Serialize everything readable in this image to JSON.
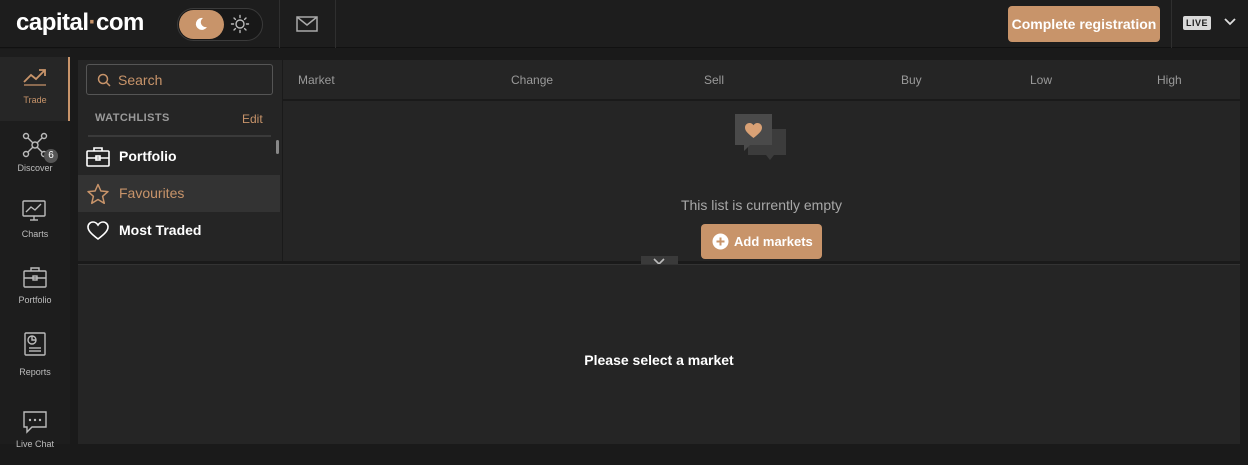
{
  "header": {
    "logo_left": "capital",
    "logo_dot": "·",
    "logo_right": "com",
    "register_label": "Complete registration",
    "account_badge": "LIVE"
  },
  "nav": {
    "items": [
      {
        "label": "Trade",
        "icon": "trend-line-icon"
      },
      {
        "label": "Discover",
        "icon": "network-icon"
      },
      {
        "label": "Charts",
        "icon": "chart-monitor-icon",
        "badge": "6"
      },
      {
        "label": "Portfolio",
        "icon": "briefcase-icon"
      },
      {
        "label": "Reports",
        "icon": "report-icon"
      },
      {
        "label": "Live Chat",
        "icon": "chat-icon"
      }
    ]
  },
  "watchlists": {
    "search_placeholder": "Search",
    "title": "WATCHLISTS",
    "edit_label": "Edit",
    "items": [
      {
        "label": "Portfolio",
        "icon": "briefcase-icon"
      },
      {
        "label": "Favourites",
        "icon": "star-icon"
      },
      {
        "label": "Most Traded",
        "icon": "heart-icon"
      }
    ]
  },
  "table": {
    "columns": [
      "Market",
      "Change",
      "Sell",
      "Buy",
      "Low",
      "High"
    ]
  },
  "list": {
    "empty_message": "This list is currently empty",
    "add_markets_label": "Add markets"
  },
  "detail": {
    "message": "Please select a market"
  },
  "colors": {
    "accent": "#c8946a",
    "background": "#1a1a1a",
    "panel": "#252525"
  }
}
